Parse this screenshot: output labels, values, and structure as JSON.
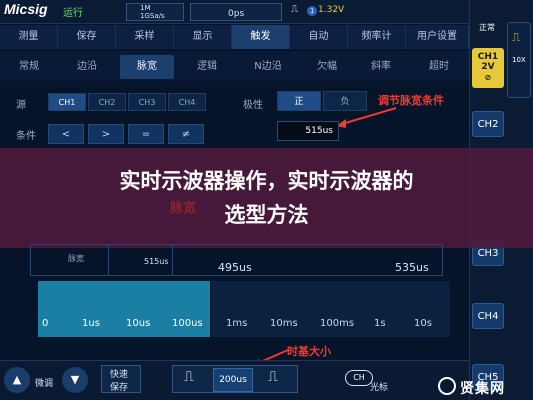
{
  "topbar": {
    "logo": "Micsig",
    "run_status": "运行",
    "sample": {
      "top": "1M",
      "bottom": "1GSa/s"
    },
    "time_offset": "0ps",
    "trigger_glyph": "⎍",
    "trigger_channel": "1",
    "trigger_level": "1.32V"
  },
  "menu": {
    "tabs": [
      "测量",
      "保存",
      "采样",
      "显示",
      "触发",
      "自动",
      "频率计",
      "用户设置"
    ],
    "active_tab": "触发",
    "subtabs": [
      "常规",
      "边沿",
      "脉宽",
      "逻辑",
      "N边沿",
      "欠幅",
      "斜率",
      "超时"
    ],
    "active_subtab": "脉宽"
  },
  "trigger": {
    "source_label": "源",
    "sources": [
      "CH1",
      "CH2",
      "CH3",
      "CH4"
    ],
    "active_source": "CH1",
    "polarity_label": "极性",
    "polarity_options": [
      "正",
      "负"
    ],
    "active_polarity": "正",
    "condition_label": "条件",
    "operators": [
      "<",
      ">",
      "=",
      "≠"
    ],
    "width_value": "515us",
    "annotation_pulse": "调节脉宽条件"
  },
  "banner": {
    "line1": "实时示波器操作，实时示波器的",
    "line2": "选型方法",
    "ghost_text": "脉宽"
  },
  "pulse_window": {
    "label": "脉宽",
    "value": "515us",
    "range_start": "495us",
    "range_end": "535us"
  },
  "timebase": {
    "ticks": [
      "0",
      "1us",
      "10us",
      "100us",
      "1ms",
      "10ms",
      "100ms",
      "1s",
      "10s"
    ],
    "current": "200us",
    "annotation": "时基大小"
  },
  "right_panel": {
    "mode": "正常",
    "ch1_label": "CH1",
    "ch1_scale": "2V",
    "channels": [
      "CH2",
      "CH3",
      "CH4",
      "CH5"
    ],
    "probe_multiplier": "10X"
  },
  "bottombar": {
    "fine_label": "微调",
    "quick_save_line1": "快速",
    "quick_save_line2": "保存",
    "cursor_label": "光标",
    "ch_icon_label": "CH",
    "watermark": "贤集网"
  },
  "colors": {
    "accent_yellow": "#e5c93a",
    "annotation_red": "#ee3b30",
    "timebase_cyan": "#1b7ea3",
    "banner_overlay": "#501a3e"
  }
}
